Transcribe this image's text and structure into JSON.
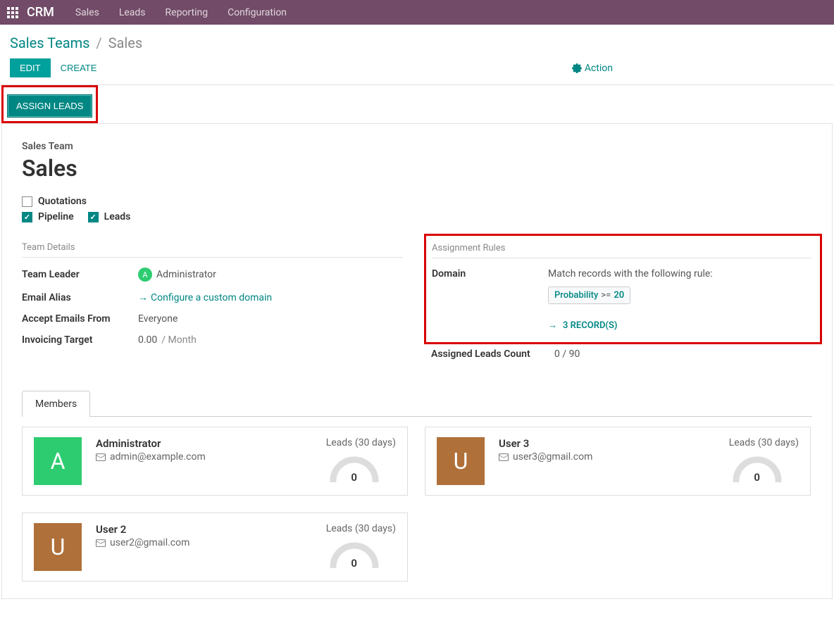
{
  "nav": {
    "app_name": "CRM",
    "items": [
      "Sales",
      "Leads",
      "Reporting",
      "Configuration"
    ]
  },
  "breadcrumb": {
    "parent": "Sales Teams",
    "current": "Sales"
  },
  "actions": {
    "edit": "EDIT",
    "create": "CREATE",
    "action_menu": "Action"
  },
  "assign_leads_button": "ASSIGN LEADS",
  "form": {
    "section_label": "Sales Team",
    "title": "Sales",
    "checkboxes": {
      "quotations": {
        "label": "Quotations",
        "checked": false
      },
      "pipeline": {
        "label": "Pipeline",
        "checked": true
      },
      "leads": {
        "label": "Leads",
        "checked": true
      }
    }
  },
  "team_details": {
    "section_title": "Team Details",
    "fields": {
      "team_leader": {
        "label": "Team Leader",
        "value": "Administrator",
        "avatar_letter": "A"
      },
      "email_alias": {
        "label": "Email Alias",
        "link": "Configure a custom domain"
      },
      "accept_emails": {
        "label": "Accept Emails From",
        "value": "Everyone"
      },
      "invoicing_target": {
        "label": "Invoicing Target",
        "value": "0.00",
        "suffix": "/ Month"
      }
    }
  },
  "assignment_rules": {
    "section_title": "Assignment Rules",
    "domain_label": "Domain",
    "domain_text": "Match records with the following rule:",
    "domain_field": "Probability",
    "domain_op": ">=",
    "domain_val": "20",
    "records_link": "3 RECORD(S)",
    "assigned_count_label": "Assigned Leads Count",
    "assigned_count_value": "0 / 90"
  },
  "tabs": {
    "members": "Members"
  },
  "members": [
    {
      "name": "Administrator",
      "email": "admin@example.com",
      "avatar_letter": "A",
      "avatar_color": "#2ecc71",
      "stats_label": "Leads (30 days)",
      "gauge_value": "0"
    },
    {
      "name": "User 3",
      "email": "user3@gmail.com",
      "avatar_letter": "U",
      "avatar_color": "#b0703a",
      "stats_label": "Leads (30 days)",
      "gauge_value": "0"
    },
    {
      "name": "User 2",
      "email": "user2@gmail.com",
      "avatar_letter": "U",
      "avatar_color": "#b0703a",
      "stats_label": "Leads (30 days)",
      "gauge_value": "0"
    }
  ]
}
